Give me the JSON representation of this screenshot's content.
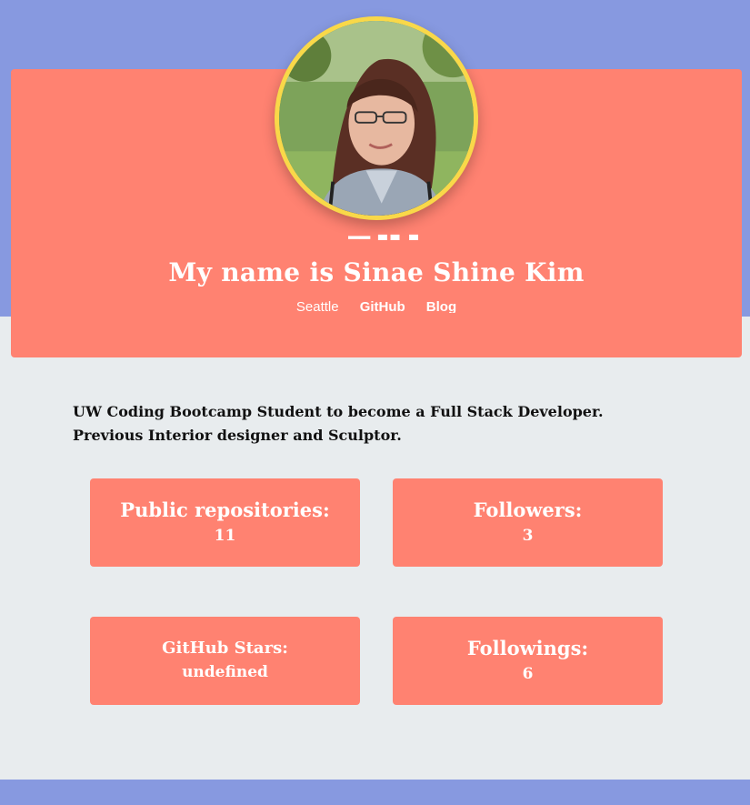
{
  "profile": {
    "name": "My name is Sinae Shine Kim",
    "links": {
      "location": "Seattle",
      "github": "GitHub",
      "blog": "Blog"
    },
    "bio_line1": "UW Coding Bootcamp Student to become a Full Stack Developer.",
    "bio_line2": "Previous Interior designer and Sculptor."
  },
  "stats": {
    "repos": {
      "label": "Public repositories:",
      "value": "11"
    },
    "followers": {
      "label": "Followers:",
      "value": "3"
    },
    "stars": {
      "label": "GitHub Stars:",
      "value": "undefined"
    },
    "followings": {
      "label": "Followings:",
      "value": "6"
    }
  },
  "colors": {
    "band": "#8799e0",
    "card": "#ff8271",
    "avatar_border": "#f9d849",
    "background": "#e8ecee"
  }
}
